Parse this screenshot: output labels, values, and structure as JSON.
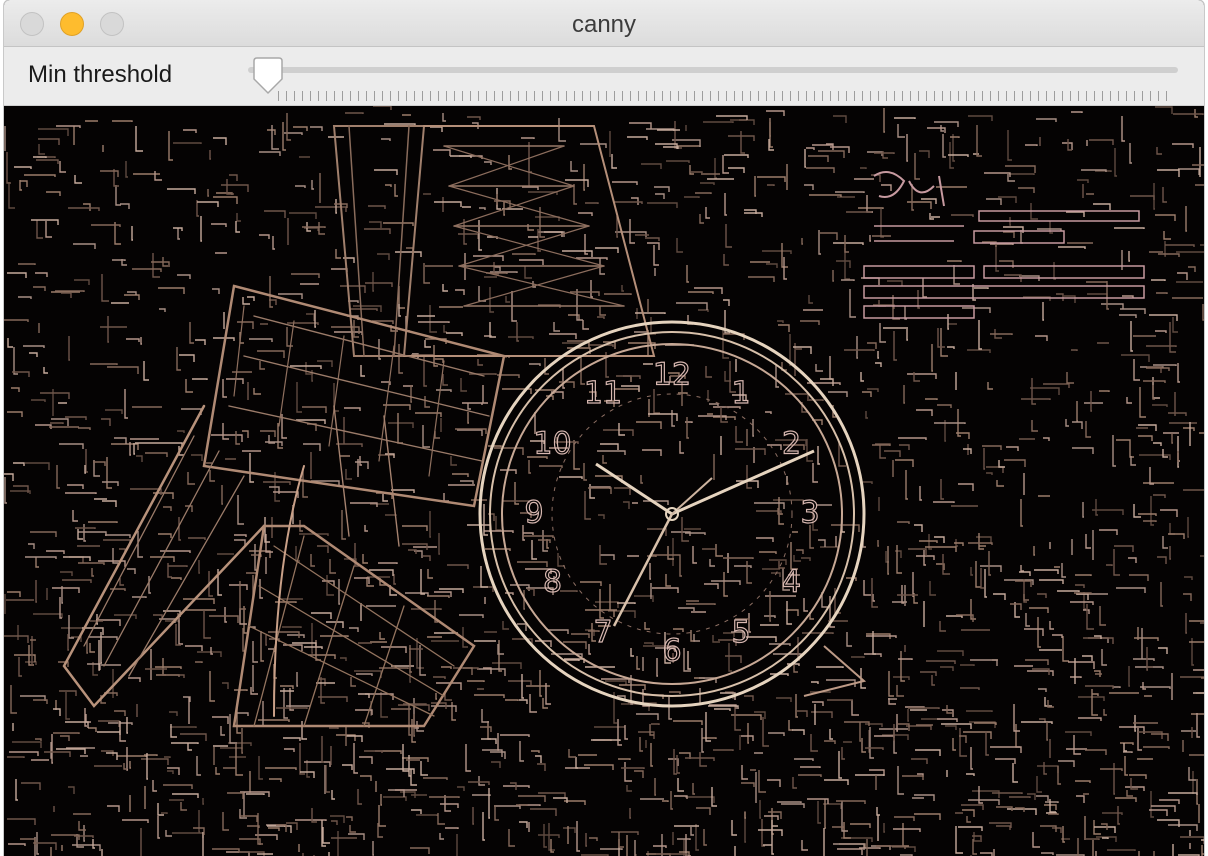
{
  "window": {
    "title": "canny"
  },
  "controls": {
    "min_threshold": {
      "label": "Min threshold",
      "value_fraction": 0.0
    }
  },
  "canvas": {
    "description_icons": [
      "eiffel-tower-edges",
      "pocket-watch-edges",
      "paper-text-edges"
    ],
    "watch_numerals": [
      "12",
      "1",
      "2",
      "3",
      "4",
      "5",
      "6",
      "7",
      "8",
      "9",
      "10",
      "11"
    ],
    "edge_colors": {
      "background": "#050303",
      "warm": "#b08a74",
      "light": "#e6d4bf",
      "pink": "#c79aa0"
    }
  }
}
